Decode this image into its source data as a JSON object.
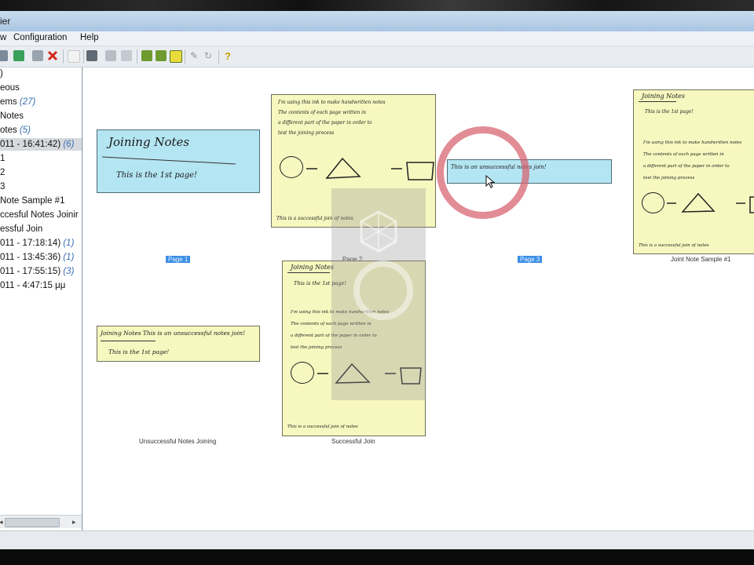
{
  "window": {
    "title": "ier"
  },
  "menu": {
    "items": [
      "w",
      "Configuration",
      "Help"
    ]
  },
  "toolbar": {
    "icons": [
      "cut-icon",
      "copy-icon",
      "paste-icon",
      "delete-icon",
      "new-icon",
      "print-icon",
      "page-icon",
      "page-copy-icon",
      "layout-grid-icon",
      "layout-tiles-icon",
      "layout-single-icon",
      "pen-icon",
      "refresh-icon",
      "help-icon"
    ]
  },
  "sidebar": {
    "items": [
      {
        "label": ")",
        "count": ""
      },
      {
        "label": "eous",
        "count": ""
      },
      {
        "label": "ems ",
        "count": "(27)"
      },
      {
        "label": "Notes",
        "count": ""
      },
      {
        "label": "otes ",
        "count": "(5)"
      },
      {
        "label": "011 - 16:41:42) ",
        "count": "(6)"
      },
      {
        "label": "1",
        "count": ""
      },
      {
        "label": "2",
        "count": ""
      },
      {
        "label": "3",
        "count": ""
      },
      {
        "label": "Note Sample #1",
        "count": ""
      },
      {
        "label": "ccesful Notes Joinir",
        "count": ""
      },
      {
        "label": "essful Join",
        "count": ""
      },
      {
        "label": "011 - 17:18:14) ",
        "count": "(1)"
      },
      {
        "label": "011 - 13:45:36) ",
        "count": "(1)"
      },
      {
        "label": "011 - 17:55:15) ",
        "count": "(3)"
      },
      {
        "label": "011 - 4:47:15 μμ",
        "count": ""
      }
    ]
  },
  "notes": {
    "page1": {
      "caption": "Page 1",
      "title_text": "Joining Notes",
      "body_text": "This is the 1st page!"
    },
    "page2": {
      "caption": "Page 2",
      "lines": [
        "I'm using this ink to make handwritten notes",
        "The contents of each page written in",
        "a different part of the paper in order to",
        "test the joining process"
      ],
      "footer_text": "This is a successful join of notes"
    },
    "page3": {
      "caption": "Page 3",
      "body_text": "This is an unsuccessful notes join!"
    },
    "joint_sample": {
      "caption": "Joint Note Sample #1",
      "title_text": "Joining Notes",
      "first_line": "This is the 1st page!",
      "lines": [
        "I'm using this ink to make handwritten notes",
        "The contents of each page written in",
        "a different part of the paper in order to",
        "test the joining process"
      ],
      "footer_text": "This is a successful join of notes"
    },
    "unsuccessful": {
      "caption": "Unsuccessful Notes Joining",
      "line1": "Joining Notes  This is an unsuccessful notes join!",
      "line2": "This is the 1st page!"
    },
    "successful": {
      "caption": "Successful Join",
      "title_text": "Joining Notes",
      "first_line": "This is the 1st page!",
      "lines": [
        "I'm using this ink to make handwritten notes",
        "The contents of each page written in",
        "a different part of the paper in order to",
        "test the joining process"
      ],
      "footer_text": "This is a successful join of notes"
    }
  },
  "colors": {
    "note_yellow": "#f7f7c0",
    "note_blue": "#b4e5f2",
    "selection_blue": "#3c8ee6",
    "highlight_ring": "#d75f6e"
  }
}
